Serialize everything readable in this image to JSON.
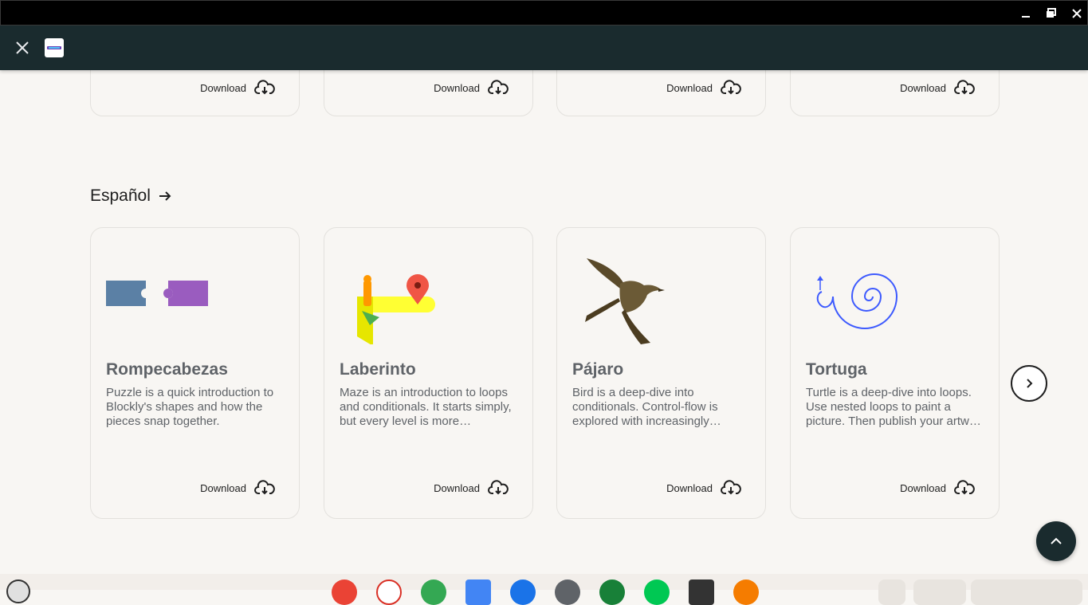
{
  "window": {
    "minimize_glyph": "▁",
    "maximize_glyph": "❐",
    "close_glyph": "✕"
  },
  "appbar": {
    "close_icon": "close-icon",
    "logo_icon": "app-logo"
  },
  "top_row": {
    "cards": [
      {
        "download_label": "Download"
      },
      {
        "download_label": "Download"
      },
      {
        "download_label": "Download"
      },
      {
        "download_label": "Download"
      }
    ]
  },
  "section": {
    "title": "Español",
    "cards": [
      {
        "title": "Rompecabezas",
        "description": "Puzzle is a quick introduction to Blockly's shapes and how the pieces snap together.",
        "image": "puzzle-pieces-image",
        "download_label": "Download"
      },
      {
        "title": "Laberinto",
        "description": "Maze is an introduction to loops and conditionals. It starts simply, but every level is more challenging than the last.",
        "image": "maze-image",
        "download_label": "Download"
      },
      {
        "title": "Pájaro",
        "description": "Bird is a deep-dive into conditionals. Control-flow is explored with increasingly complex conditionals.",
        "image": "bird-image",
        "download_label": "Download"
      },
      {
        "title": "Tortuga",
        "description": "Turtle is a deep-dive into loops. Use nested loops to paint a picture. Then publish your artwork to the gallery.",
        "image": "turtle-spiral-image",
        "download_label": "Download"
      }
    ]
  },
  "colors": {
    "appbar": "#1a2b2e",
    "background": "#f8f6f3",
    "card_title": "#5f6368",
    "puzzle_blue": "#5b80a5",
    "puzzle_purple": "#9a5cbf",
    "spiral_blue": "#3d5afe"
  },
  "shelf": {
    "apps": [
      "chrome-icon",
      "gmail-icon",
      "drive-icon",
      "docs-icon",
      "files-icon",
      "settings-icon",
      "app-icon",
      "play-store-icon",
      "terminal-icon",
      "app-orange-icon"
    ]
  }
}
